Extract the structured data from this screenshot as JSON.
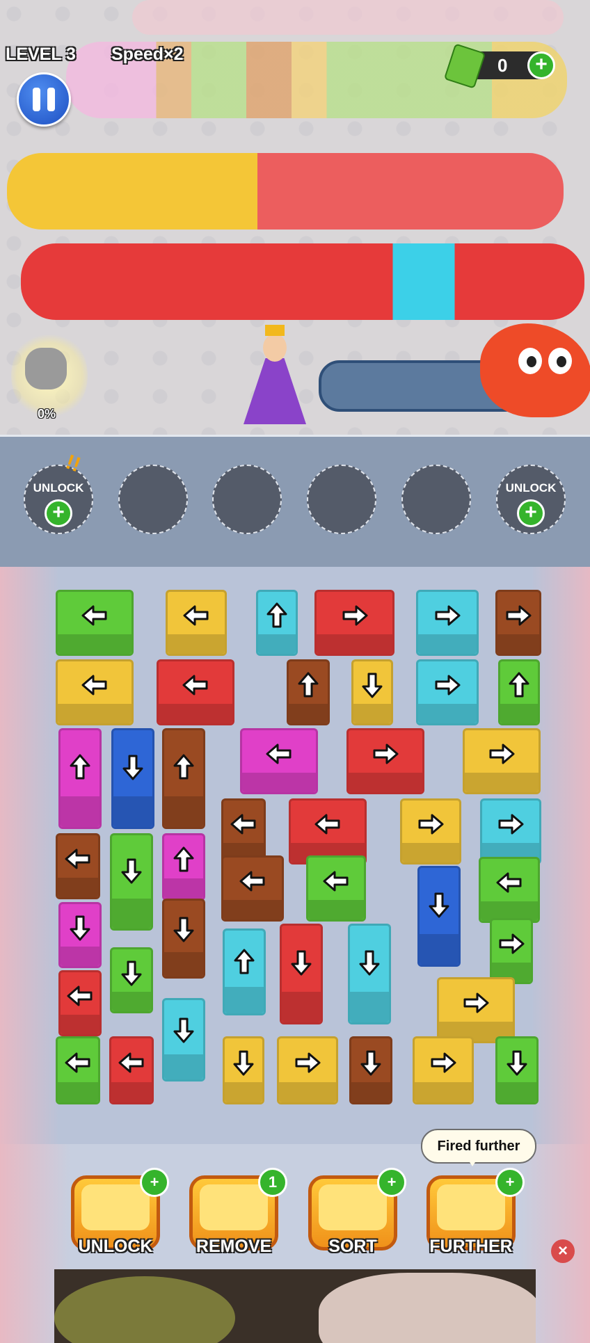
{
  "hud": {
    "level": "LEVEL 3",
    "speed": "Speed×2",
    "coins": "0",
    "pet_progress": "0%"
  },
  "slots": [
    {
      "label": "UNLOCK",
      "locked": true,
      "alert": "!!"
    },
    {
      "label": "",
      "locked": false
    },
    {
      "label": "",
      "locked": false
    },
    {
      "label": "",
      "locked": false
    },
    {
      "label": "",
      "locked": false
    },
    {
      "label": "UNLOCK",
      "locked": true
    }
  ],
  "colors": {
    "green": "#5fcb3a",
    "yellow": "#f1c53a",
    "cyan": "#4fcfe0",
    "red": "#e23a3a",
    "brown": "#9a4a22",
    "magenta": "#e040c8",
    "blue": "#2e66d6"
  },
  "boxes": [
    {
      "color": "green",
      "dir": "left"
    },
    {
      "color": "yellow",
      "dir": "left"
    },
    {
      "color": "cyan",
      "dir": "up"
    },
    {
      "color": "red",
      "dir": "right"
    },
    {
      "color": "cyan",
      "dir": "right"
    },
    {
      "color": "brown",
      "dir": "right"
    },
    {
      "color": "yellow",
      "dir": "left"
    },
    {
      "color": "red",
      "dir": "left"
    },
    {
      "color": "brown",
      "dir": "up"
    },
    {
      "color": "yellow",
      "dir": "down"
    },
    {
      "color": "cyan",
      "dir": "right"
    },
    {
      "color": "green",
      "dir": "up"
    },
    {
      "color": "magenta",
      "dir": "up"
    },
    {
      "color": "blue",
      "dir": "down"
    },
    {
      "color": "brown",
      "dir": "up"
    },
    {
      "color": "magenta",
      "dir": "left"
    },
    {
      "color": "red",
      "dir": "right"
    },
    {
      "color": "yellow",
      "dir": "right"
    },
    {
      "color": "brown",
      "dir": "left"
    },
    {
      "color": "red",
      "dir": "left"
    },
    {
      "color": "yellow",
      "dir": "right"
    },
    {
      "color": "cyan",
      "dir": "right"
    },
    {
      "color": "brown",
      "dir": "left"
    },
    {
      "color": "green",
      "dir": "down"
    },
    {
      "color": "magenta",
      "dir": "up"
    },
    {
      "color": "brown",
      "dir": "left"
    },
    {
      "color": "green",
      "dir": "left"
    },
    {
      "color": "blue",
      "dir": "down"
    },
    {
      "color": "green",
      "dir": "left"
    },
    {
      "color": "magenta",
      "dir": "down"
    },
    {
      "color": "brown",
      "dir": "down"
    },
    {
      "color": "cyan",
      "dir": "up"
    },
    {
      "color": "red",
      "dir": "down"
    },
    {
      "color": "cyan",
      "dir": "down"
    },
    {
      "color": "green",
      "dir": "right"
    },
    {
      "color": "green",
      "dir": "down"
    },
    {
      "color": "red",
      "dir": "left"
    },
    {
      "color": "yellow",
      "dir": "right"
    },
    {
      "color": "cyan",
      "dir": "down"
    },
    {
      "color": "green",
      "dir": "left"
    },
    {
      "color": "red",
      "dir": "left"
    },
    {
      "color": "yellow",
      "dir": "down"
    },
    {
      "color": "yellow",
      "dir": "right"
    },
    {
      "color": "brown",
      "dir": "down"
    },
    {
      "color": "yellow",
      "dir": "right"
    },
    {
      "color": "green",
      "dir": "down"
    }
  ],
  "tools": [
    {
      "label": "UNLOCK",
      "badge": "+"
    },
    {
      "label": "REMOVE",
      "badge": "1"
    },
    {
      "label": "SORT",
      "badge": "+"
    },
    {
      "label": "FURTHER",
      "badge": "+"
    }
  ],
  "tooltip": "Fired further",
  "ad_close": "×"
}
